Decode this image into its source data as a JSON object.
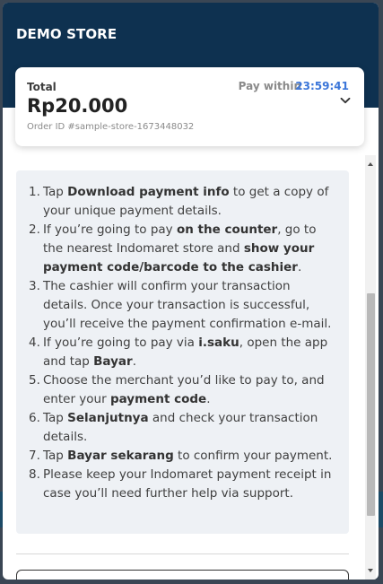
{
  "store": {
    "name": "DEMO STORE"
  },
  "summary": {
    "total_label": "Total",
    "amount": "Rp20.000",
    "order_id": "Order ID #sample-store-1673448032",
    "pay_within_label": "Pay within",
    "countdown": "23:59:41"
  },
  "instructions": [
    {
      "num": "1.",
      "parts": [
        {
          "t": "Tap "
        },
        {
          "b": "Download payment info"
        },
        {
          "t": " to get a copy of your unique payment details."
        }
      ]
    },
    {
      "num": "2.",
      "parts": [
        {
          "t": "If you’re going to pay "
        },
        {
          "b": "on the counter"
        },
        {
          "t": ", go to the nearest Indomaret store and "
        },
        {
          "b": "show your payment code/barcode to the cashier"
        },
        {
          "t": "."
        }
      ]
    },
    {
      "num": "3.",
      "parts": [
        {
          "t": "The cashier will confirm your transaction details. Once your transaction is successful, you’ll receive the payment confirmation e-mail."
        }
      ]
    },
    {
      "num": "4.",
      "parts": [
        {
          "t": "If you’re going to pay via "
        },
        {
          "b": "i.saku"
        },
        {
          "t": ", open the app and tap "
        },
        {
          "b": "Bayar"
        },
        {
          "t": "."
        }
      ]
    },
    {
      "num": "5.",
      "parts": [
        {
          "t": "Choose the merchant you’d like to pay to, and enter your "
        },
        {
          "b": "payment code"
        },
        {
          "t": "."
        }
      ]
    },
    {
      "num": "6.",
      "parts": [
        {
          "t": "Tap "
        },
        {
          "b": "Selanjutnya"
        },
        {
          "t": " and check your transaction details."
        }
      ]
    },
    {
      "num": "7.",
      "parts": [
        {
          "t": "Tap "
        },
        {
          "b": "Bayar sekarang"
        },
        {
          "t": " to confirm your payment."
        }
      ]
    },
    {
      "num": "8.",
      "parts": [
        {
          "t": "Please keep your Indomaret payment receipt in case you’ll need further help via support."
        }
      ]
    }
  ],
  "icons": {
    "expand": "chevron-down-icon",
    "scroll_up": "arrow-up-icon",
    "scroll_down": "arrow-down-icon"
  },
  "colors": {
    "header_bg": "#0e3150",
    "countdown": "#3b76d9",
    "instructions_bg": "#eef1f5"
  }
}
